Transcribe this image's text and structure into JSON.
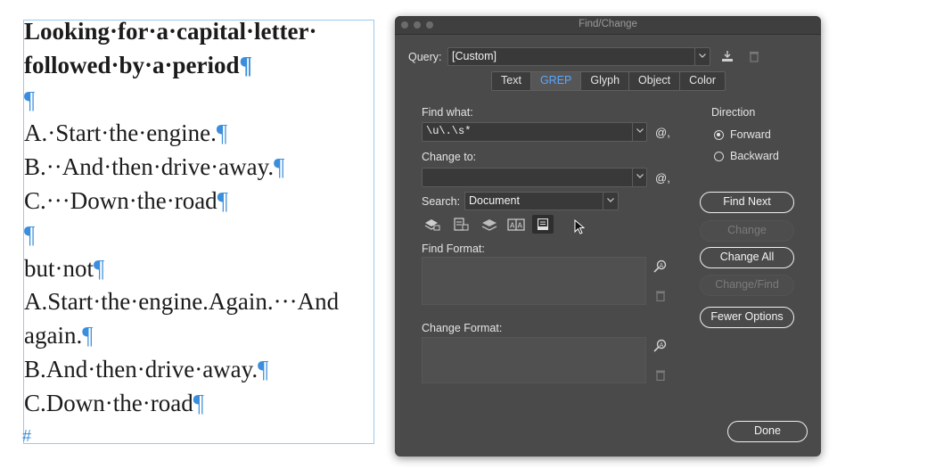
{
  "document": {
    "lines": [
      {
        "text": "Looking·for·a·capital·letter·",
        "pilcrow": "",
        "bold": true
      },
      {
        "text": "followed·by·a·period",
        "pilcrow": "¶",
        "bold": true
      },
      {
        "text": "",
        "pilcrow": "¶",
        "bold": false
      },
      {
        "text": "A.·Start·the·engine.",
        "pilcrow": "¶",
        "bold": false
      },
      {
        "text": "B.··And·then·drive·away.",
        "pilcrow": "¶",
        "bold": false
      },
      {
        "text": "C.···Down·the·road",
        "pilcrow": "¶",
        "bold": false
      },
      {
        "text": "",
        "pilcrow": "¶",
        "bold": false
      },
      {
        "text": "but·not",
        "pilcrow": "¶",
        "bold": false
      },
      {
        "text": "A.Start·the·engine.Again.···And",
        "pilcrow": "",
        "bold": false
      },
      {
        "text": "again.",
        "pilcrow": "¶",
        "bold": false
      },
      {
        "text": "B.And·then·drive·away.",
        "pilcrow": "¶",
        "bold": false
      },
      {
        "text": "C.Down·the·road",
        "pilcrow": "¶",
        "bold": false
      }
    ],
    "end_mark": "#"
  },
  "dialog": {
    "title": "Find/Change",
    "query_label": "Query:",
    "query_value": "[Custom]",
    "tabs": [
      {
        "label": "Text",
        "active": false
      },
      {
        "label": "GREP",
        "active": true
      },
      {
        "label": "Glyph",
        "active": false
      },
      {
        "label": "Object",
        "active": false
      },
      {
        "label": "Color",
        "active": false
      }
    ],
    "find_what_label": "Find what:",
    "find_what_value": "\\u\\.\\s*",
    "change_to_label": "Change to:",
    "change_to_value": "",
    "special_char_label": "@,",
    "search_label": "Search:",
    "search_value": "Document",
    "direction_label": "Direction",
    "forward_label": "Forward",
    "backward_label": "Backward",
    "forward_selected": true,
    "find_format_label": "Find Format:",
    "change_format_label": "Change Format:",
    "buttons": {
      "find_next": "Find Next",
      "change": "Change",
      "change_all": "Change All",
      "change_find": "Change/Find",
      "fewer_options": "Fewer Options",
      "done": "Done"
    }
  },
  "colors": {
    "accent": "#5aa7ff",
    "pilcrow": "#3b8edb",
    "frame": "#9cc8ee",
    "dialog_bg": "#4a4a4a"
  }
}
